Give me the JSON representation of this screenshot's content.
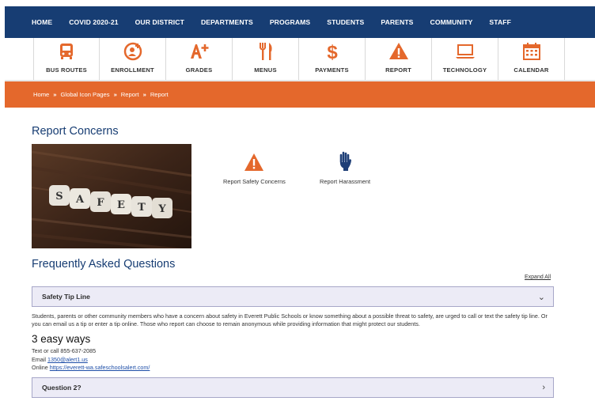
{
  "nav": {
    "items": [
      "HOME",
      "COVID 2020-21",
      "OUR DISTRICT",
      "DEPARTMENTS",
      "PROGRAMS",
      "STUDENTS",
      "PARENTS",
      "COMMUNITY",
      "STAFF"
    ]
  },
  "iconbar": {
    "items": [
      {
        "label": "BUS ROUTES",
        "icon": "bus-icon"
      },
      {
        "label": "ENROLLMENT",
        "icon": "enrollment-icon"
      },
      {
        "label": "GRADES",
        "icon": "grades-icon"
      },
      {
        "label": "MENUS",
        "icon": "utensils-icon"
      },
      {
        "label": "PAYMENTS",
        "icon": "dollar-icon"
      },
      {
        "label": "REPORT",
        "icon": "warning-icon"
      },
      {
        "label": "TECHNOLOGY",
        "icon": "laptop-icon"
      },
      {
        "label": "CALENDAR",
        "icon": "calendar-icon"
      }
    ],
    "accent": "#e4682c"
  },
  "breadcrumb": {
    "items": [
      "Home",
      "Global Icon Pages",
      "Report",
      "Report"
    ],
    "separator": "»"
  },
  "page": {
    "title": "Report Concerns",
    "image_text": "SAFETY"
  },
  "report_links": {
    "safety": "Report Safety Concerns",
    "harassment": "Report Harassment"
  },
  "faq": {
    "title": "Frequently Asked Questions",
    "expand_all": "Expand All",
    "items": [
      {
        "question": "Safety Tip Line",
        "answer": "Students, parents or other community members who have a concern about safety in Everett Public Schools or know something about a possible threat to safety, are urged to call or text the safety tip line. Or you can email us a tip or enter a tip online. Those who report can choose to remain anonymous while providing information that might protect our students.",
        "heading": "3 easy ways",
        "text_call": "Text or call 855-637-2085",
        "email_prefix": "Email",
        "email": "1350@alert1.us",
        "online_prefix": "Online",
        "online_url": "https://everett-wa.safeschoolsalert.com/"
      },
      {
        "question": "Question 2?"
      }
    ]
  },
  "colors": {
    "nav_bg": "#173d73",
    "breadcrumb_bg": "#e4682c",
    "heading": "#173d73",
    "accordion_bg": "#ecebf6"
  }
}
